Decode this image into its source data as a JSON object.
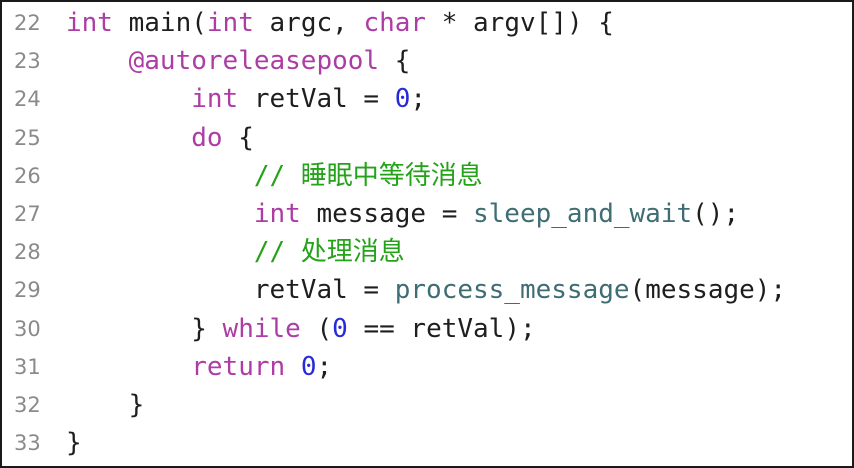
{
  "colors": {
    "keyword": "#ad3da4",
    "number": "#272ad8",
    "function": "#3e6d74",
    "comment": "#24a319",
    "plain": "#1e1e1e",
    "line_number": "#8a8a8a"
  },
  "lines": [
    {
      "number": "22",
      "tokens": [
        {
          "type": "kw",
          "text": "int"
        },
        {
          "type": "pl",
          "text": " main("
        },
        {
          "type": "kw",
          "text": "int"
        },
        {
          "type": "pl",
          "text": " argc, "
        },
        {
          "type": "kw",
          "text": "char"
        },
        {
          "type": "pl",
          "text": " * argv[]) {"
        }
      ]
    },
    {
      "number": "23",
      "tokens": [
        {
          "type": "pl",
          "text": "    "
        },
        {
          "type": "kw",
          "text": "@autoreleasepool"
        },
        {
          "type": "pl",
          "text": " {"
        }
      ]
    },
    {
      "number": "24",
      "tokens": [
        {
          "type": "pl",
          "text": "        "
        },
        {
          "type": "kw",
          "text": "int"
        },
        {
          "type": "pl",
          "text": " retVal = "
        },
        {
          "type": "num",
          "text": "0"
        },
        {
          "type": "pl",
          "text": ";"
        }
      ]
    },
    {
      "number": "25",
      "tokens": [
        {
          "type": "pl",
          "text": "        "
        },
        {
          "type": "kw",
          "text": "do"
        },
        {
          "type": "pl",
          "text": " {"
        }
      ]
    },
    {
      "number": "26",
      "tokens": [
        {
          "type": "pl",
          "text": "            "
        },
        {
          "type": "cm",
          "text": "// 睡眠中等待消息"
        }
      ]
    },
    {
      "number": "27",
      "tokens": [
        {
          "type": "pl",
          "text": "            "
        },
        {
          "type": "kw",
          "text": "int"
        },
        {
          "type": "pl",
          "text": " message = "
        },
        {
          "type": "fn",
          "text": "sleep_and_wait"
        },
        {
          "type": "pl",
          "text": "();"
        }
      ]
    },
    {
      "number": "28",
      "tokens": [
        {
          "type": "pl",
          "text": "            "
        },
        {
          "type": "cm",
          "text": "// 处理消息"
        }
      ]
    },
    {
      "number": "29",
      "tokens": [
        {
          "type": "pl",
          "text": "            retVal = "
        },
        {
          "type": "fn",
          "text": "process_message"
        },
        {
          "type": "pl",
          "text": "(message);"
        }
      ]
    },
    {
      "number": "30",
      "tokens": [
        {
          "type": "pl",
          "text": "        } "
        },
        {
          "type": "kw",
          "text": "while"
        },
        {
          "type": "pl",
          "text": " ("
        },
        {
          "type": "num",
          "text": "0"
        },
        {
          "type": "pl",
          "text": " == retVal);"
        }
      ]
    },
    {
      "number": "31",
      "tokens": [
        {
          "type": "pl",
          "text": "        "
        },
        {
          "type": "kw",
          "text": "return"
        },
        {
          "type": "pl",
          "text": " "
        },
        {
          "type": "num",
          "text": "0"
        },
        {
          "type": "pl",
          "text": ";"
        }
      ]
    },
    {
      "number": "32",
      "tokens": [
        {
          "type": "pl",
          "text": "    }"
        }
      ]
    },
    {
      "number": "33",
      "tokens": [
        {
          "type": "pl",
          "text": "}"
        }
      ]
    }
  ]
}
